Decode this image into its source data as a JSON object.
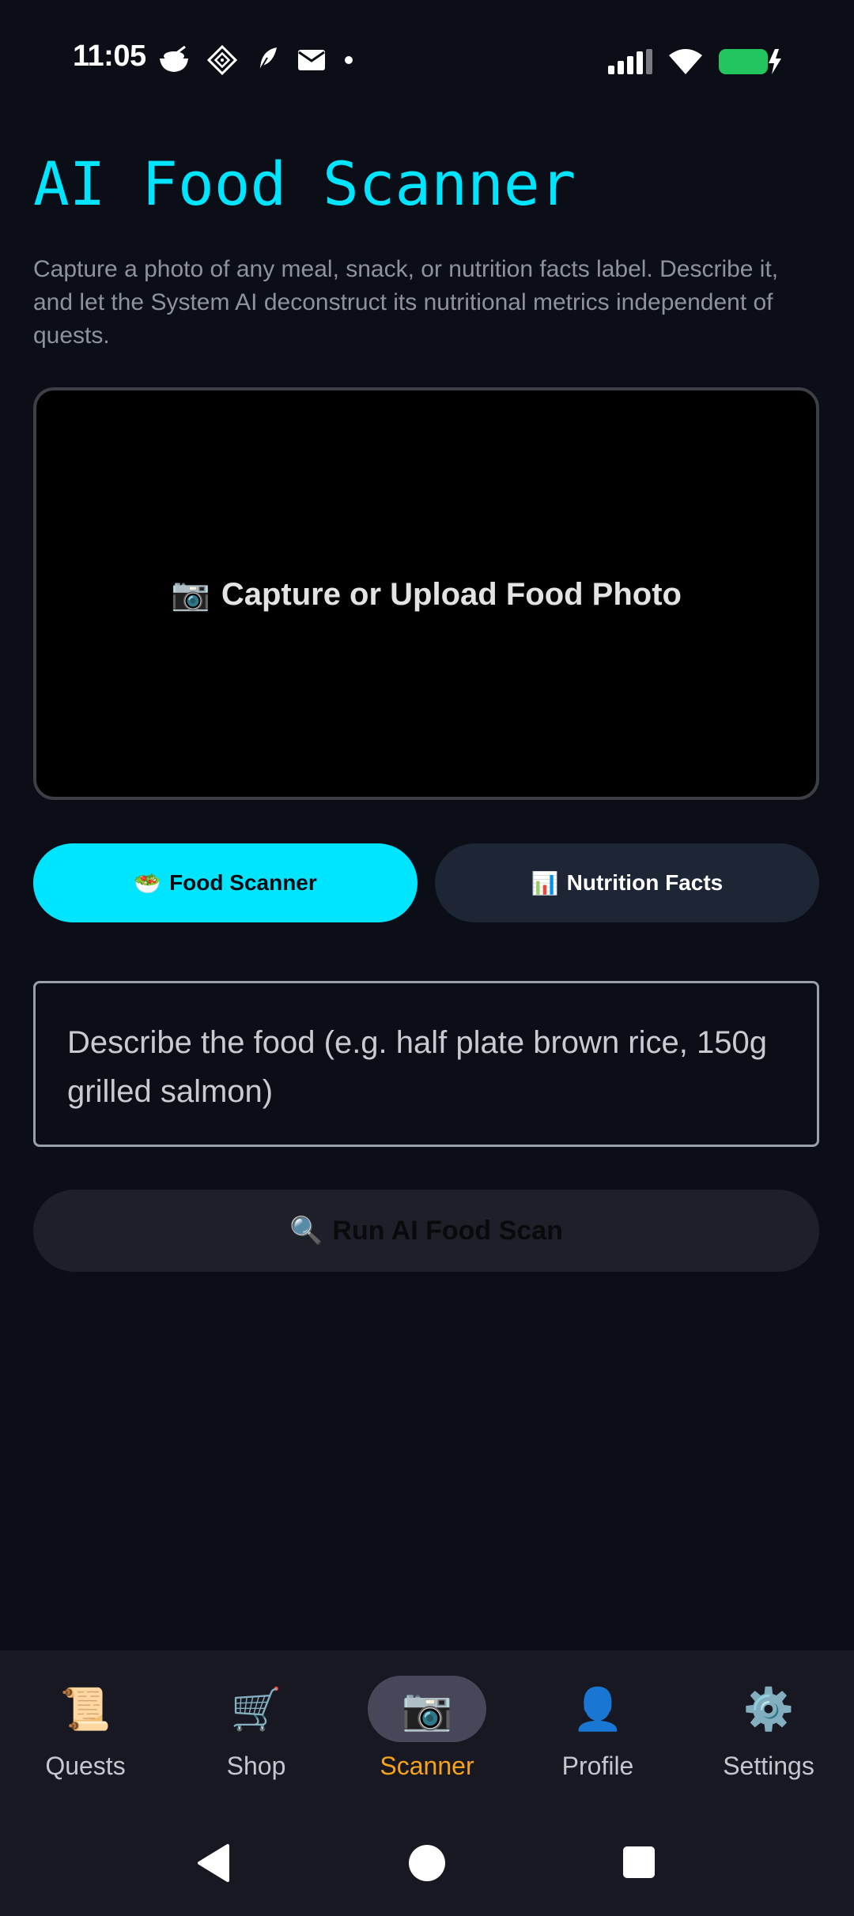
{
  "status_bar": {
    "time": "11:05",
    "left_icons": [
      "rice-bowl-icon",
      "diamond-grid-icon",
      "feather-icon",
      "mail-icon",
      "dot-icon"
    ],
    "right_icons": [
      "signal-icon",
      "wifi-icon",
      "battery-charging-icon"
    ],
    "battery_color": "#22c55e"
  },
  "page": {
    "title": "AI Food Scanner",
    "description": "Capture a photo of any meal, snack, or nutrition facts label. Describe it, and let the System AI deconstruct its nutritional metrics independent of quests."
  },
  "photo_box": {
    "emoji": "📷",
    "label": "Capture or Upload Food Photo"
  },
  "modes": {
    "food": {
      "emoji": "🥗",
      "label": "Food Scanner",
      "active": true
    },
    "nutrition": {
      "emoji": "📊",
      "label": "Nutrition Facts",
      "active": false
    }
  },
  "describe_input": {
    "placeholder": "Describe the food (e.g. half plate brown rice, 150g grilled salmon)"
  },
  "run_button": {
    "emoji": "🔍",
    "label": "Run AI Food Scan"
  },
  "bottom_nav": {
    "items": [
      {
        "emoji": "📜",
        "label": "Quests"
      },
      {
        "emoji": "🛒",
        "label": "Shop"
      },
      {
        "emoji": "📷",
        "label": "Scanner"
      },
      {
        "emoji": "👤",
        "label": "Profile"
      },
      {
        "emoji": "⚙️",
        "label": "Settings"
      }
    ],
    "active": "Scanner"
  },
  "colors": {
    "background": "#0b0e17",
    "accent_cyan": "#00e5ff",
    "active_nav": "#f7a21b",
    "secondary_button": "#1e2535"
  }
}
